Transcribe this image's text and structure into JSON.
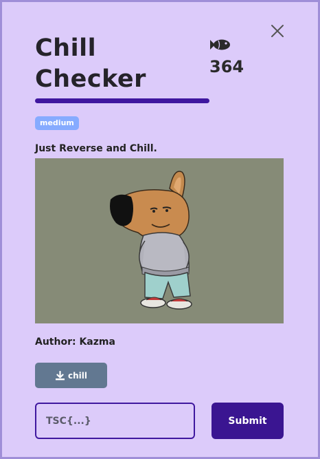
{
  "challenge": {
    "title": "Chill Checker",
    "points": "364",
    "points_icon": "fish-icon",
    "difficulty": "medium",
    "description": "Just Reverse and Chill.",
    "author": "Author: Kazma",
    "file_button_label": "chill",
    "file_button_icon": "download-icon",
    "close_icon": "close-icon"
  },
  "flag_form": {
    "placeholder": "TSC{...}",
    "value": "",
    "submit_label": "Submit"
  },
  "colors": {
    "background": "#dccbfa",
    "accent": "#3f179f",
    "badge": "#86abff",
    "download_button": "#627891"
  }
}
